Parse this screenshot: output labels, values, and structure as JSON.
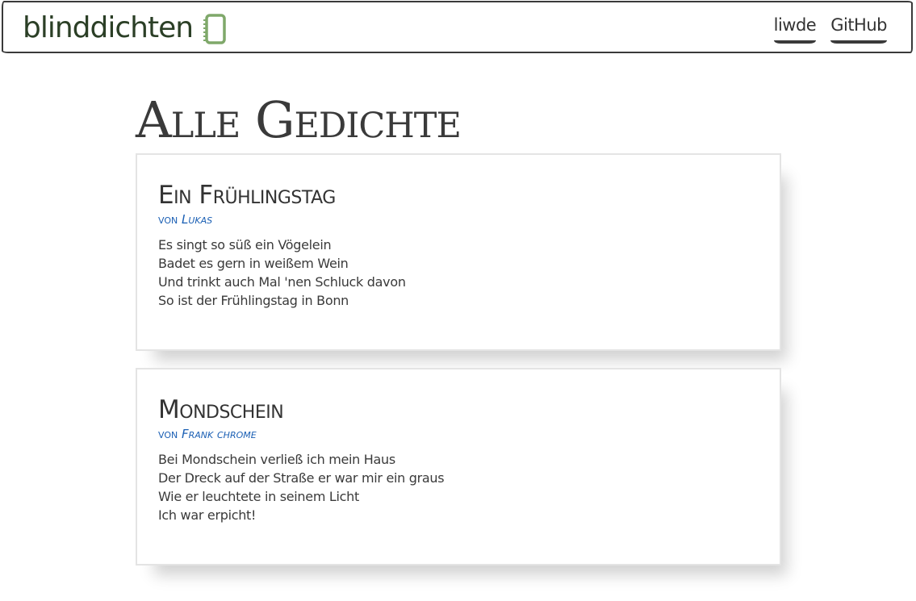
{
  "navbar": {
    "brand": "blinddichten",
    "brand_icon": "notebook-icon",
    "links": [
      {
        "label": "liwde"
      },
      {
        "label": "GitHub"
      }
    ]
  },
  "page": {
    "title": "Alle Gedichte"
  },
  "poems": [
    {
      "title": "Ein Frühlingstag",
      "by": "von",
      "author": "Lukas",
      "lines": [
        "Es singt so süß ein Vögelein",
        "Badet es gern in weißem Wein",
        "Und trinkt auch Mal 'nen Schluck davon",
        "So ist der Frühlingstag in Bonn"
      ]
    },
    {
      "title": "Mondschein",
      "by": "von",
      "author": "Frank chrome",
      "lines": [
        "Bei Mondschein verließ ich mein Haus",
        "Der Dreck auf der Straße er war mir ein graus",
        "Wie er leuchtete in seinem Licht",
        "Ich war erpicht!"
      ]
    }
  ],
  "colors": {
    "brand": "#2b3f26",
    "brand_icon": "#7fa86a",
    "author_link": "#1a5fb4",
    "text": "#333333"
  }
}
